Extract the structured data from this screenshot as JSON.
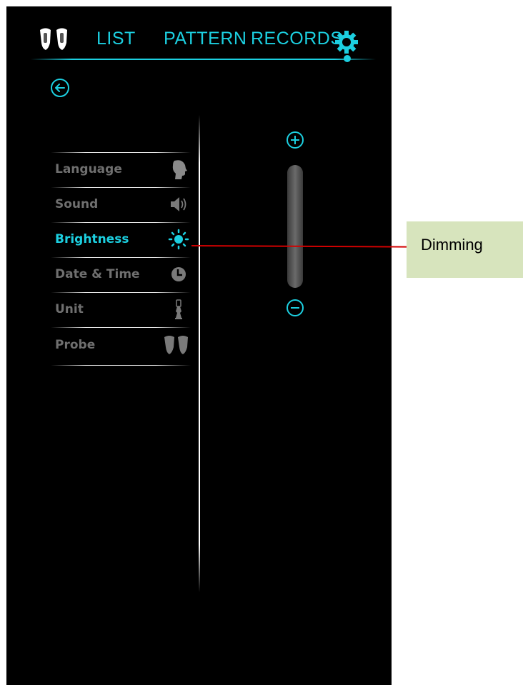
{
  "nav": {
    "items": [
      {
        "label": "LIST"
      },
      {
        "label": "PATTERN"
      },
      {
        "label": "RECORDS"
      }
    ],
    "probe_icon": "probe-pair-icon",
    "settings_icon": "gear-icon",
    "active_tab": "settings"
  },
  "back_icon": "back-arrow-icon",
  "menu": {
    "items": [
      {
        "label": "Language",
        "icon": "head-profile-icon"
      },
      {
        "label": "Sound",
        "icon": "speaker-icon"
      },
      {
        "label": "Brightness",
        "icon": "sun-icon",
        "active": true
      },
      {
        "label": "Date & Time",
        "icon": "clock-icon"
      },
      {
        "label": "Unit",
        "icon": "unit-icon"
      },
      {
        "label": "Probe",
        "icon": "probe-icon"
      }
    ]
  },
  "brightness_slider": {
    "plus_icon": "plus-icon",
    "minus_icon": "minus-icon"
  },
  "callout": {
    "label": "Dimming"
  },
  "colors": {
    "accent": "#1ccfe0",
    "background": "#000000",
    "inactive_text": "#6f6f6f",
    "callout_bg": "#d7e4bd",
    "callout_line": "#d20000"
  }
}
